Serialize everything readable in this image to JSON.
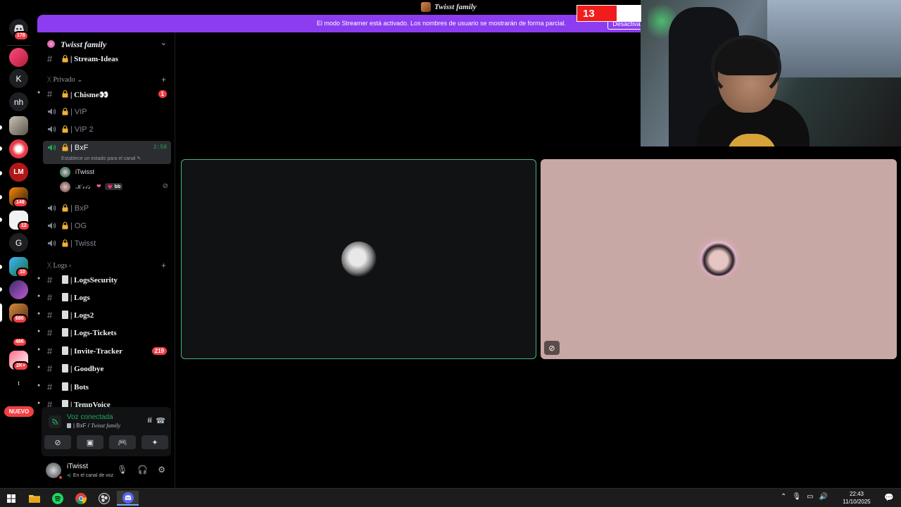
{
  "window": {
    "title": "Twisst family"
  },
  "banner": {
    "text": "El modo Streamer está activado. Los nombres de usuario se mostrarán de forma parcial.",
    "button": "Desactivar"
  },
  "counter": {
    "value": "13"
  },
  "rail": {
    "servers": [
      {
        "label": "",
        "badge": "178",
        "kind": "discord"
      },
      {
        "label": "",
        "badge": "",
        "kind": "img"
      },
      {
        "label": "K",
        "badge": ""
      },
      {
        "label": "nh",
        "badge": ""
      },
      {
        "label": "",
        "badge": "",
        "kind": "img"
      },
      {
        "label": "",
        "badge": "",
        "kind": "img"
      },
      {
        "label": "",
        "badge": "",
        "kind": "img"
      },
      {
        "label": "",
        "badge": "149",
        "kind": "img"
      },
      {
        "label": "",
        "badge": "12",
        "kind": "img"
      },
      {
        "label": "G",
        "badge": ""
      },
      {
        "label": "",
        "badge": "10",
        "kind": "img"
      },
      {
        "label": "",
        "badge": "",
        "kind": "img"
      },
      {
        "label": "",
        "badge": "680",
        "kind": "img"
      },
      {
        "label": "",
        "badge": "486",
        "kind": "img"
      },
      {
        "label": "",
        "badge": "2K+",
        "kind": "img"
      }
    ],
    "nuevo": "NUEVO"
  },
  "guild": {
    "name": "Twisst family"
  },
  "channels_top": [
    {
      "name": "| Stream-Ideas",
      "type": "text"
    }
  ],
  "categories": {
    "privado": "Privado",
    "logs": "Logs"
  },
  "voice_channels": [
    {
      "name": "| Chisme👀",
      "type": "text",
      "count": "1"
    },
    {
      "name": "| VIP",
      "type": "voice"
    },
    {
      "name": "| VIP 2",
      "type": "voice"
    },
    {
      "name": "| BxF",
      "type": "voice",
      "timer": "2:58",
      "status": "Establece un estado para el canal"
    },
    {
      "name": "| BxP",
      "type": "voice"
    },
    {
      "name": "| OG",
      "type": "voice"
    },
    {
      "name": "| Twisst",
      "type": "voice"
    }
  ],
  "voice_users": [
    {
      "name": "iTwisst"
    },
    {
      "name": "𝒦𝓇𝒾𝓈",
      "tag": "bb"
    }
  ],
  "log_channels": [
    {
      "name": "| LogsSecurity"
    },
    {
      "name": "| Logs"
    },
    {
      "name": "| Logs2"
    },
    {
      "name": "| Logs-Tickets"
    },
    {
      "name": "| Invite-Tracker",
      "count": "219"
    },
    {
      "name": "| Goodbye"
    },
    {
      "name": "| Bots"
    },
    {
      "name": "| TempVoice"
    }
  ],
  "voice_panel": {
    "title": "Voz conectada",
    "channel": "| BxF / ",
    "guild": "Twisst family"
  },
  "user_panel": {
    "name": "iTwisst",
    "status": "En el canal de voz"
  },
  "taskbar": {
    "time": "22:43",
    "date": "11/10/2025"
  },
  "colors": {
    "accent": "#8c3df0",
    "connected": "#23a55a",
    "badge": "#f23f43"
  }
}
